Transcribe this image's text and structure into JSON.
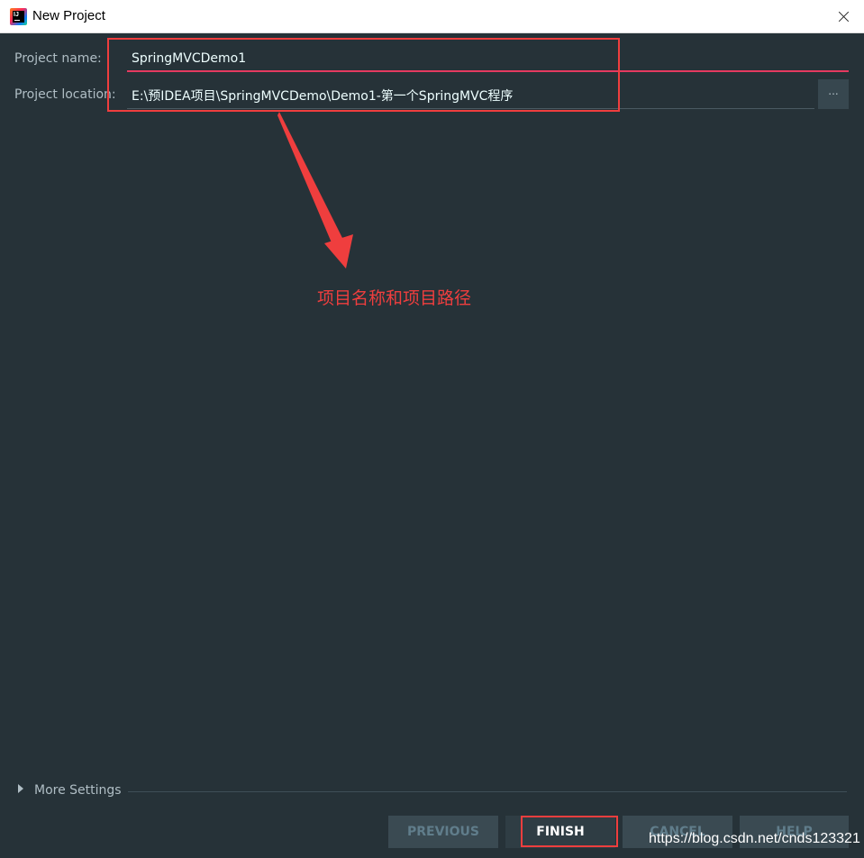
{
  "window": {
    "title": "New Project",
    "app_icon": "intellij-idea-icon",
    "app_icon_text": "IJ"
  },
  "form": {
    "name_label": "Project name:",
    "name_value": "SpringMVCDemo1",
    "location_label": "Project location:",
    "location_value": "E:\\预IDEA项目\\SpringMVCDemo\\Demo1-第一个SpringMVC程序",
    "browse_label": "..."
  },
  "annotation": {
    "text": "项目名称和项目路径"
  },
  "footer": {
    "more_settings": "More Settings",
    "buttons": {
      "previous": "PREVIOUS",
      "finish": "FINISH",
      "cancel": "CANCEL",
      "help": "HELP"
    }
  },
  "watermark": "https://blog.csdn.net/cnds123321",
  "colors": {
    "background": "#263238",
    "accent_underline": "#e53a60",
    "annotation_red": "#ef3e3e"
  }
}
